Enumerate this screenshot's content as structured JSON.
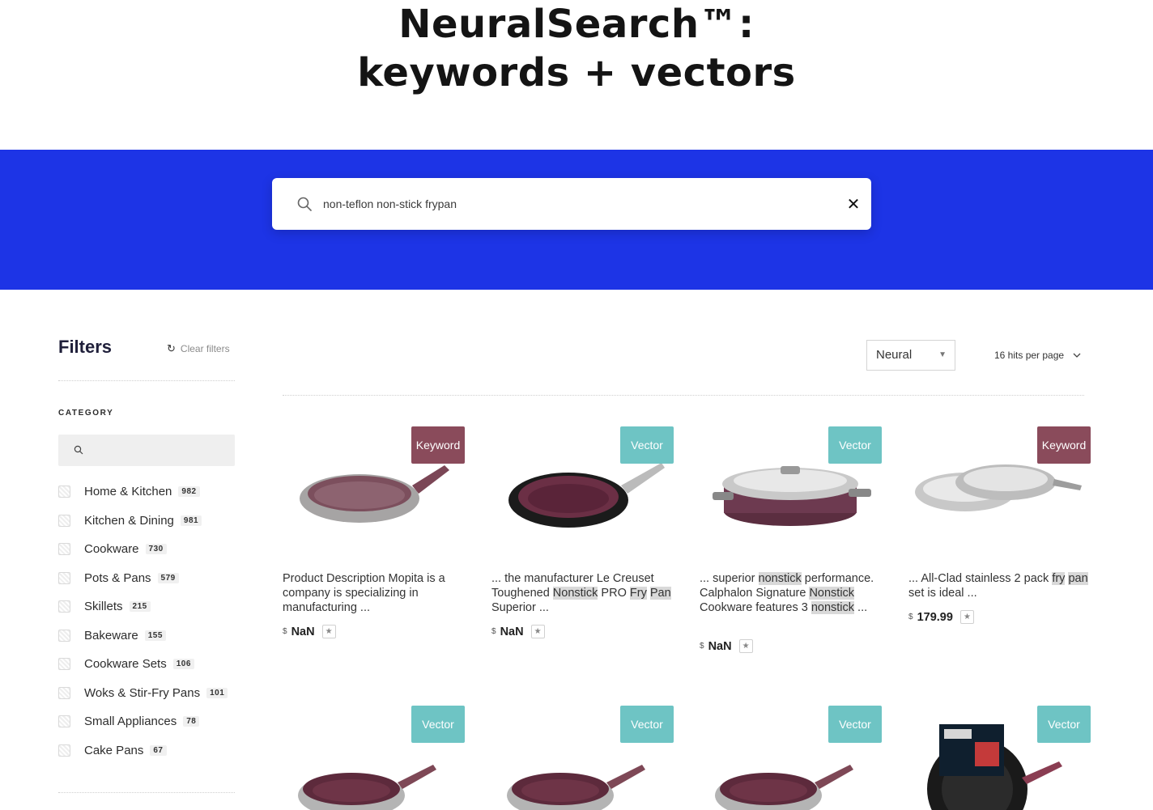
{
  "hero": {
    "line1": "NeuralSearch™:",
    "line2": "keywords + vectors"
  },
  "search": {
    "query": "non-teflon non-stick frypan",
    "search_icon": "search-icon",
    "clear_icon": "close-icon",
    "clear_glyph": "✕"
  },
  "colors": {
    "band": "#1d34e6",
    "keyword_badge": "#8a4b5b",
    "vector_badge": "#6ec4c4"
  },
  "filters": {
    "title": "Filters",
    "clear_label": "Clear filters",
    "category_label": "CATEGORY",
    "categories": [
      {
        "name": "Home & Kitchen",
        "count": "982"
      },
      {
        "name": "Kitchen & Dining",
        "count": "981"
      },
      {
        "name": "Cookware",
        "count": "730"
      },
      {
        "name": "Pots & Pans",
        "count": "579"
      },
      {
        "name": "Skillets",
        "count": "215"
      },
      {
        "name": "Bakeware",
        "count": "155"
      },
      {
        "name": "Cookware Sets",
        "count": "106"
      },
      {
        "name": "Woks & Stir-Fry Pans",
        "count": "101"
      },
      {
        "name": "Small Appliances",
        "count": "78"
      },
      {
        "name": "Cake Pans",
        "count": "67"
      }
    ]
  },
  "toolbar": {
    "sort_value": "Neural",
    "hits_label": "16 hits per page"
  },
  "results": [
    {
      "badge": "Keyword",
      "image": "pan-rose-grey-icon",
      "desc": [
        {
          "t": "Product Description Mopita is a company is specializing in manufacturing ..."
        }
      ],
      "currency": "$",
      "price": "NaN"
    },
    {
      "badge": "Vector",
      "image": "pan-black-icon",
      "desc": [
        {
          "t": "... the manufacturer Le Creuset Toughened "
        },
        {
          "t": "Nonstick",
          "h": true
        },
        {
          "t": " PRO "
        },
        {
          "t": "Fry",
          "h": true
        },
        {
          "t": " "
        },
        {
          "t": "Pan",
          "h": true
        },
        {
          "t": " Superior ..."
        }
      ],
      "currency": "$",
      "price": "NaN"
    },
    {
      "badge": "Vector",
      "image": "saute-pan-lid-icon",
      "desc": [
        {
          "t": "... superior "
        },
        {
          "t": "nonstick",
          "h": true
        },
        {
          "t": " performance. Calphalon Signature "
        },
        {
          "t": "Nonstick",
          "h": true
        },
        {
          "t": " Cookware features 3 "
        },
        {
          "t": "nonstick",
          "h": true
        },
        {
          "t": " ..."
        }
      ],
      "currency": "$",
      "price": "NaN"
    },
    {
      "badge": "Keyword",
      "image": "steel-pans-icon",
      "desc": [
        {
          "t": "... All-Clad stainless 2 pack "
        },
        {
          "t": "fry",
          "h": true
        },
        {
          "t": " "
        },
        {
          "t": "pan",
          "h": true
        },
        {
          "t": " set is ideal ..."
        }
      ],
      "currency": "$",
      "price": "179.99"
    },
    {
      "badge": "Vector",
      "image": "pan-steel-plum-icon"
    },
    {
      "badge": "Vector",
      "image": "pan-steel-plum-icon"
    },
    {
      "badge": "Vector",
      "image": "pan-steel-plum-icon"
    },
    {
      "badge": "Vector",
      "image": "packaged-pan-icon"
    }
  ]
}
